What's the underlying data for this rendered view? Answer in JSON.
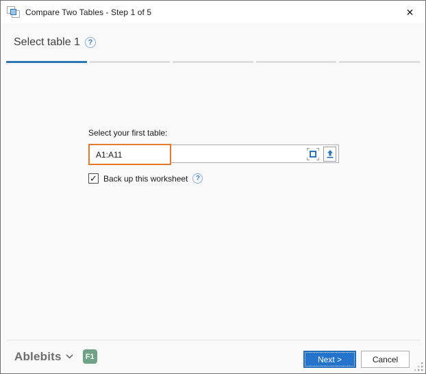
{
  "window": {
    "title": "Compare Two Tables - Step 1 of 5"
  },
  "icons": {
    "close": "✕",
    "help": "?",
    "check": "✓"
  },
  "header": {
    "title": "Select table 1"
  },
  "steps": {
    "total": 5,
    "current": 1
  },
  "form": {
    "table_label": "Select your first table:",
    "range_value": "A1:A11",
    "backup": {
      "label": "Back up this worksheet",
      "checked": true
    }
  },
  "footer": {
    "brand": "Ablebits",
    "f1_badge": "F1",
    "next_label": "Next >",
    "cancel_label": "Cancel"
  },
  "colors": {
    "accent_blue": "#2e75b6",
    "button_blue": "#2574cc",
    "orange_highlight": "#e8772e",
    "f1_green": "#6fa287",
    "inactive_tab": "#dedede"
  }
}
